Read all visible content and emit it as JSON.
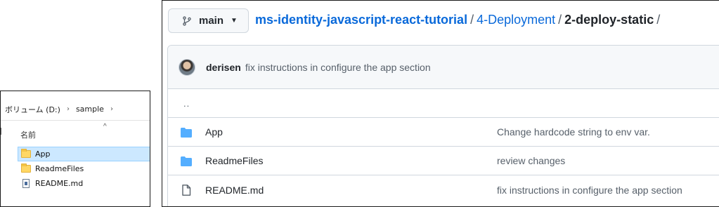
{
  "explorer": {
    "path": [
      "ボリューム (D:)",
      "sample"
    ],
    "column_header": "名前",
    "items": [
      {
        "name": "App",
        "type": "folder",
        "selected": true
      },
      {
        "name": "ReadmeFiles",
        "type": "folder",
        "selected": false
      },
      {
        "name": "README.md",
        "type": "file",
        "selected": false
      }
    ]
  },
  "github": {
    "branch": "main",
    "breadcrumb": {
      "repo": "ms-identity-javascript-react-tutorial",
      "folder": "4-Deployment",
      "current": "2-deploy-static",
      "separator": "/"
    },
    "latest_commit": {
      "author": "derisen",
      "message": "fix instructions in configure the app section"
    },
    "parent_dir": "..",
    "files": [
      {
        "name": "App",
        "type": "folder",
        "message": "Change hardcode string to env var."
      },
      {
        "name": "ReadmeFiles",
        "type": "folder",
        "message": "review changes"
      },
      {
        "name": "README.md",
        "type": "file",
        "message": "fix instructions in configure the app section"
      }
    ]
  },
  "colors": {
    "link": "#0969da",
    "folder_icon_github": "#54aeff",
    "explorer_selection": "#cce8ff"
  }
}
